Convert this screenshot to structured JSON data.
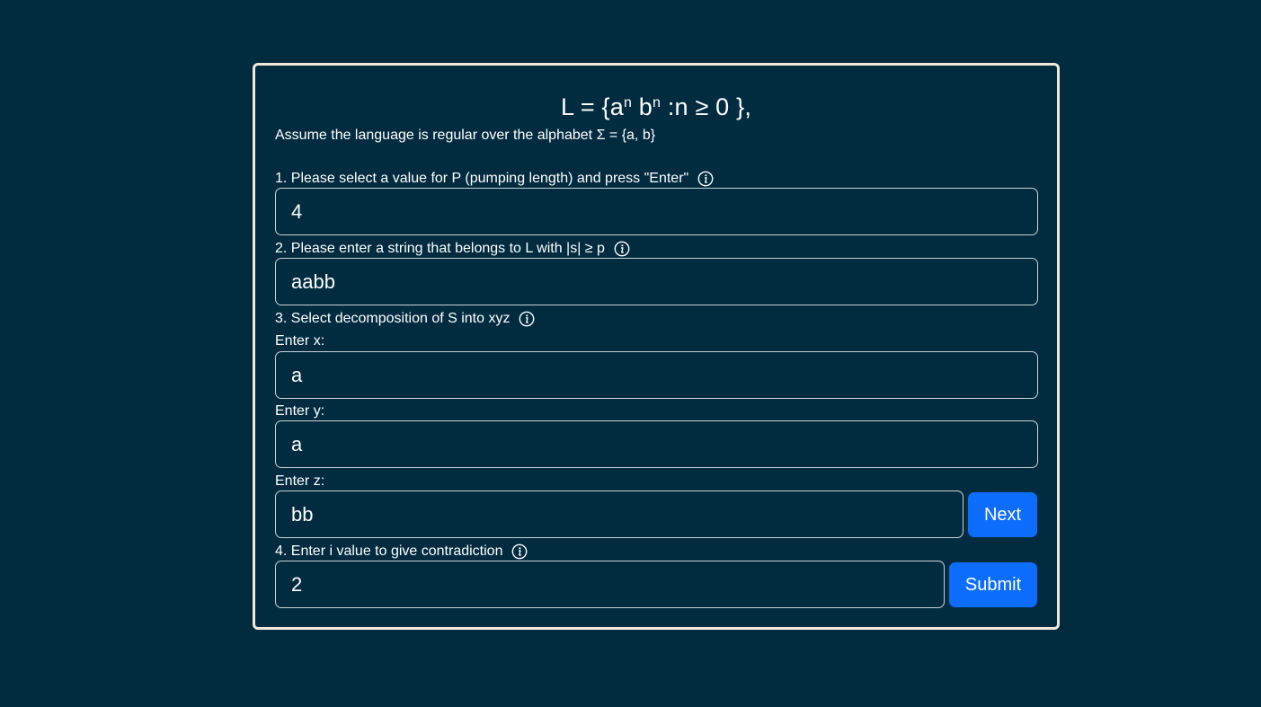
{
  "header": {
    "title_prefix": "L = {a",
    "title_exp1": "n",
    "title_mid": " b",
    "title_exp2": "n",
    "title_suffix": " :n ≥ 0 },",
    "subtitle": "Assume the language is regular over the alphabet Σ = {a, b}"
  },
  "steps": {
    "step1_label": "1. Please select a value for P (pumping length) and press \"Enter\"",
    "step1_value": "4",
    "step2_label": "2. Please enter a string that belongs to L with |s| ≥ p",
    "step2_value": "aabb",
    "step3_label": "3. Select decomposition of S into xyz",
    "x_label": "Enter x:",
    "x_value": "a",
    "y_label": "Enter y:",
    "y_value": "a",
    "z_label": "Enter z:",
    "z_value": "bb",
    "next_label": "Next",
    "step4_label": "4. Enter i value to give contradiction",
    "i_value": "2",
    "submit_label": "Submit"
  },
  "icons": {
    "info": "info-circle-icon"
  },
  "colors": {
    "background": "#012c40",
    "card_border": "#f1ead9",
    "button": "#0d6efd"
  }
}
